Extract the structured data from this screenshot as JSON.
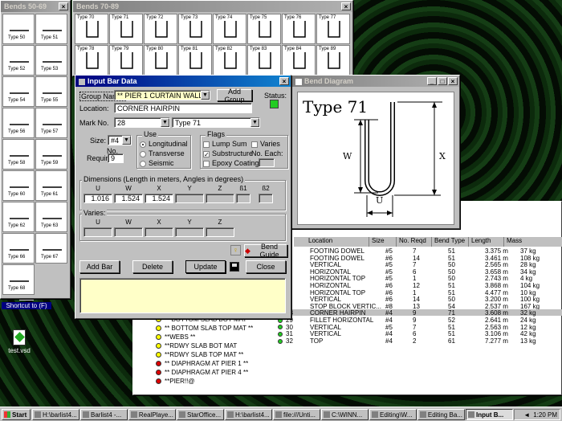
{
  "bends_50_69": {
    "title": "Bends 50-69",
    "items": [
      "Type 50",
      "Type 51",
      "Type 52",
      "Type 53",
      "Type 54",
      "Type 55",
      "Type 56",
      "Type 57",
      "Type 58",
      "Type 59",
      "Type 60",
      "Type 61",
      "Type 62",
      "Type 63",
      "Type 66",
      "Type 67",
      "Type 68"
    ]
  },
  "bends_70_89": {
    "title": "Bends 70-89",
    "items": [
      "Type 70",
      "Type 71",
      "Type 72",
      "Type 73",
      "Type 74",
      "Type 75",
      "Type 76",
      "Type 77",
      "Type 78",
      "Type 79",
      "Type 80",
      "Type 81",
      "Type 82",
      "Type 83",
      "Type 84",
      "Type 89"
    ]
  },
  "input_bar": {
    "title": "Input Bar Data",
    "group_name_label": "Group Name:",
    "group_name_value": "** PIER 1 CURTAIN WALL **",
    "add_group": "Add Group",
    "status_label": "Status:",
    "status_color": "#22cc22",
    "location_label": "Location:",
    "location_value": "CORNER HAIRPIN",
    "mark_label": "Mark No.",
    "mark_value": "28",
    "type_value": "Type 71",
    "size_label": "Size:",
    "size_value": "#4",
    "no_required_label1": "No.",
    "no_required_label2": "Required:",
    "no_required_value": "9",
    "use_title": "Use",
    "use_options": [
      "Longitudinal",
      "Transverse",
      "Seismic"
    ],
    "use_selected": 0,
    "flags_title": "Flags",
    "flag_lump": "Lump Sum",
    "flag_sub": "Substructure",
    "flag_epoxy": "Epoxy Coating",
    "flag_varies": "Varies",
    "no_each": "No. Each:",
    "dims_title": "Dimensions (Length in meters, Angles in degrees)",
    "dim_headers": [
      "U",
      "W",
      "X",
      "Y",
      "Z",
      "ß1",
      "ß2"
    ],
    "dim_values": [
      "1.016",
      "1.524",
      "1.524",
      "",
      "",
      "",
      ""
    ],
    "varies_title": "Varies:",
    "varies_headers": [
      "U",
      "W",
      "X",
      "Y",
      "Z"
    ],
    "bend_guide": "Bend Guide",
    "add_bar": "Add Bar",
    "delete": "Delete",
    "update": "Update",
    "close": "Close"
  },
  "bend_diagram": {
    "title": "Bend Diagram",
    "type_label": "Type 71",
    "labels": {
      "w": "W",
      "x": "X",
      "u": "U"
    }
  },
  "bar_table": {
    "headers": [
      "Location",
      "Size",
      "No. Reqd",
      "Bend Type",
      "Length",
      "Mass"
    ],
    "rows": [
      {
        "n": "",
        "loc": "FOOTING DOWEL",
        "size": "#5",
        "req": "7",
        "bend": "51",
        "len": "3.375 m",
        "mass": "37 kg"
      },
      {
        "n": "",
        "loc": "FOOTING DOWEL",
        "size": "#6",
        "req": "14",
        "bend": "51",
        "len": "3.461 m",
        "mass": "108 kg"
      },
      {
        "n": "",
        "loc": "VERTICAL",
        "size": "#5",
        "req": "7",
        "bend": "50",
        "len": "2.565 m",
        "mass": "28 kg"
      },
      {
        "n": "",
        "loc": "HORIZONTAL",
        "size": "#5",
        "req": "6",
        "bend": "50",
        "len": "3.658 m",
        "mass": "34 kg"
      },
      {
        "n": "",
        "loc": "HORIZONTAL TOP",
        "size": "#5",
        "req": "1",
        "bend": "50",
        "len": "2.743 m",
        "mass": "4 kg"
      },
      {
        "n": "",
        "loc": "HORIZONTAL",
        "size": "#6",
        "req": "12",
        "bend": "51",
        "len": "3.868 m",
        "mass": "104 kg"
      },
      {
        "n": "",
        "loc": "HORIZONTAL TOP",
        "size": "#6",
        "req": "1",
        "bend": "51",
        "len": "4.477 m",
        "mass": "10 kg"
      },
      {
        "n": "",
        "loc": "VERTICAL",
        "size": "#6",
        "req": "14",
        "bend": "50",
        "len": "3.200 m",
        "mass": "100 kg"
      },
      {
        "n": "",
        "loc": "STOP BLOCK VERTIC...",
        "size": "#8",
        "req": "13",
        "bend": "54",
        "len": "2.537 m",
        "mass": "167 kg"
      },
      {
        "n": "28",
        "loc": "CORNER HAIRPIN",
        "size": "#4",
        "req": "9",
        "bend": "71",
        "len": "3.608 m",
        "mass": "32 kg"
      },
      {
        "n": "29",
        "loc": "FILLET HORIZONTAL",
        "size": "#4",
        "req": "9",
        "bend": "52",
        "len": "2.641 m",
        "mass": "24 kg"
      },
      {
        "n": "30",
        "loc": "VERTICAL",
        "size": "#5",
        "req": "7",
        "bend": "51",
        "len": "2.563 m",
        "mass": "12 kg"
      },
      {
        "n": "31",
        "loc": "VERTICAL",
        "size": "#4",
        "req": "6",
        "bend": "51",
        "len": "3.106 m",
        "mass": "42 kg"
      },
      {
        "n": "32",
        "loc": "TOP",
        "size": "#4",
        "req": "2",
        "bend": "61",
        "len": "7.277 m",
        "mass": "13 kg"
      }
    ]
  },
  "groups_list": [
    {
      "label": "** BOTTOM SLAB BOT MAT **",
      "color": "#ffff00"
    },
    {
      "label": "** BOTTOM SLAB TOP MAT **",
      "color": "#ffff00"
    },
    {
      "label": "**WEBS **",
      "color": "#ffff00"
    },
    {
      "label": "**RDWY SLAB BOT MAT",
      "color": "#ffff00"
    },
    {
      "label": "**RDWY SLAB TOP MAT **",
      "color": "#ffff00"
    },
    {
      "label": "** DIAPHRAGM AT PIER 1 **",
      "color": "#dd0000"
    },
    {
      "label": "** DIAPHRAGM AT PIER 4 **",
      "color": "#dd0000"
    },
    {
      "label": "**PIER!!@",
      "color": "#dd0000"
    }
  ],
  "desktop_icons": [
    {
      "label": "Shortcut to (F)"
    },
    {
      "label": "test.vsd"
    }
  ],
  "taskbar": {
    "start": "Start",
    "tasks": [
      "H:\\barlist4...",
      "Barlist4 -...",
      "RealPlaye...",
      "StarOffice...",
      "H:\\barlist4...",
      "file:///Unti...",
      "C:\\WINN...",
      "Editing\\W...",
      "Editing Ba...",
      "Input B..."
    ],
    "clock": "1:20 PM"
  }
}
